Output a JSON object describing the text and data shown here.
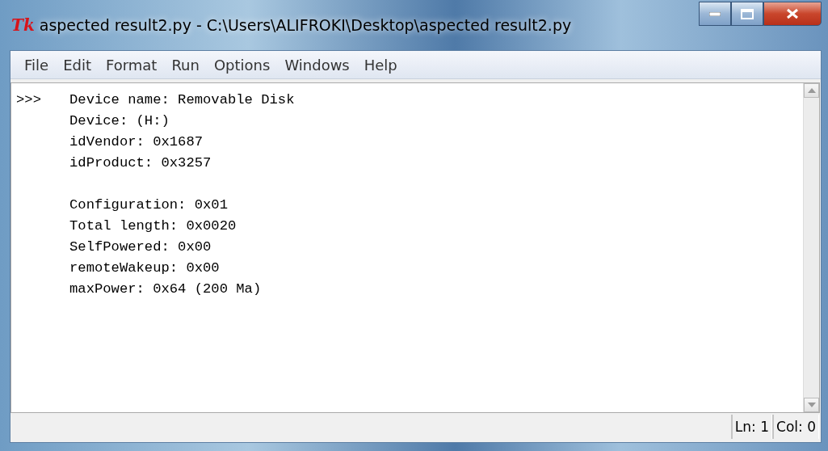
{
  "window": {
    "logo": "Tk",
    "title": "aspected result2.py - C:\\Users\\ALIFROKI\\Desktop\\aspected result2.py"
  },
  "menu": [
    "File",
    "Edit",
    "Format",
    "Run",
    "Options",
    "Windows",
    "Help"
  ],
  "shell": {
    "prompt": ">>>",
    "blocks": [
      [
        "Device name: Removable Disk",
        "Device: (H:)",
        "idVendor: 0x1687",
        "idProduct: 0x3257"
      ],
      [
        "Configuration: 0x01",
        "Total length: 0x0020",
        "SelfPowered: 0x00",
        "remoteWakeup: 0x00",
        "maxPower: 0x64 (200 Ma)"
      ]
    ]
  },
  "status_bar": [
    "Ln: 1",
    "Col: 0"
  ]
}
